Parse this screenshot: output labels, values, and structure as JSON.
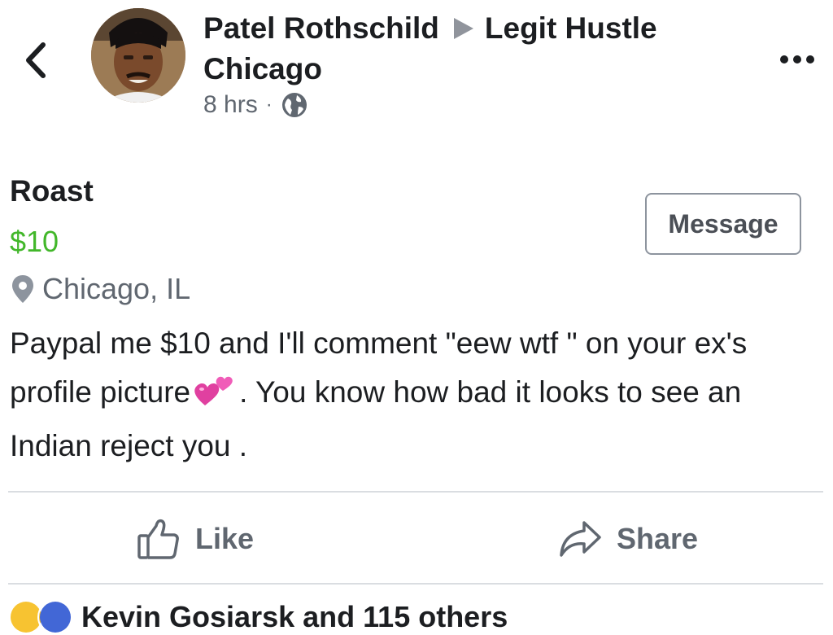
{
  "header": {
    "author": "Patel Rothschild",
    "group": "Legit Hustle",
    "group_line2": "Chicago",
    "time": "8 hrs",
    "separator": "·"
  },
  "listing": {
    "title": "Roast",
    "price": "$10",
    "location": "Chicago, IL",
    "message_button": "Message",
    "description_part1": "Paypal me $10 and I'll comment \"eew wtf \" on your ex's profile picture",
    "description_part2": ". You know how bad it looks to see an Indian reject you ."
  },
  "actions": {
    "like": "Like",
    "share": "Share"
  },
  "reactions": {
    "summary": "Kevin Gosiarsk and 115 others"
  },
  "colors": {
    "price": "#42b72a",
    "secondary_text": "#606770",
    "divider": "#dadde1"
  },
  "icons": {
    "back": "chevron-left-icon",
    "more": "more-horizontal-icon",
    "privacy": "globe-icon",
    "location": "map-pin-icon",
    "like": "thumbs-up-icon",
    "share": "share-arrow-icon",
    "emoji": "two-hearts-emoji"
  }
}
